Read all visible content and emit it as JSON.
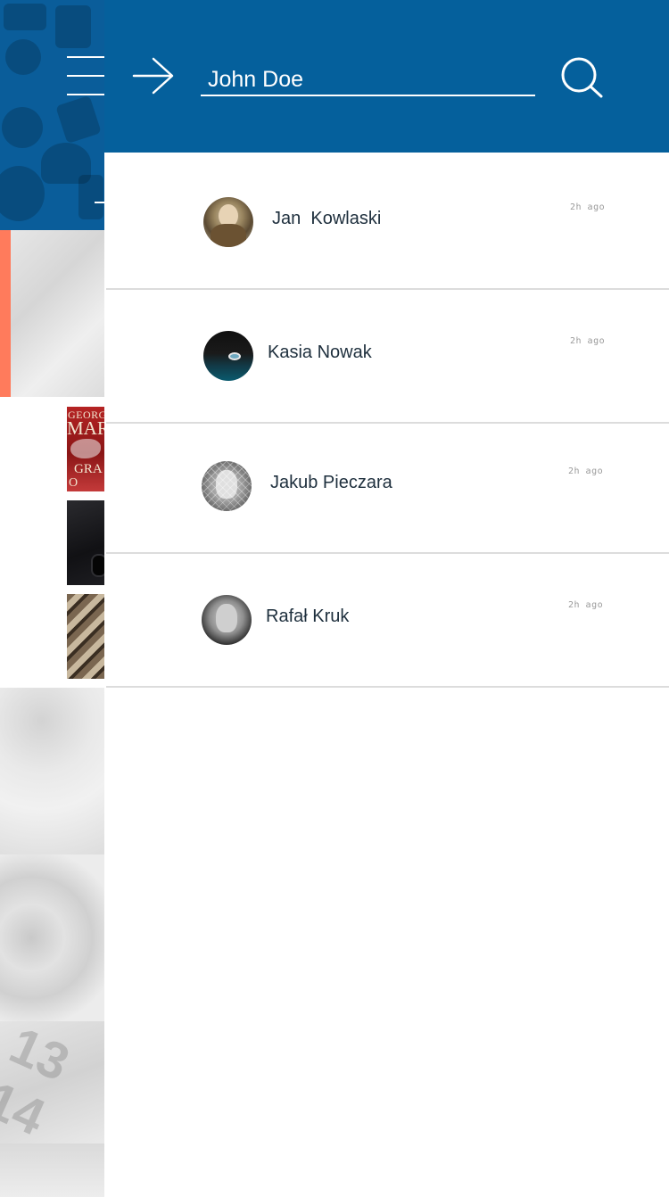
{
  "search": {
    "query": "John Doe"
  },
  "results": [
    {
      "name": "Jan  Kowlaski",
      "time": "2h ago"
    },
    {
      "name": "Kasia Nowak",
      "time": "2h ago"
    },
    {
      "name": "Jakub Pieczara",
      "time": "2h ago"
    },
    {
      "name": "Rafał Kruk",
      "time": "2h ago"
    }
  ],
  "background": {
    "book_cover_lines": [
      "GEORG",
      "MAR",
      "GRA",
      "O TRO"
    ]
  },
  "colors": {
    "header": "#05609c",
    "accent": "#ff7b5c",
    "name_text": "#1e2f3d",
    "time_text": "#9a9a9a",
    "divider": "#dcdcdc"
  },
  "icons": {
    "menu": "hamburger-icon",
    "back": "arrow-right-icon",
    "search": "search-icon"
  }
}
